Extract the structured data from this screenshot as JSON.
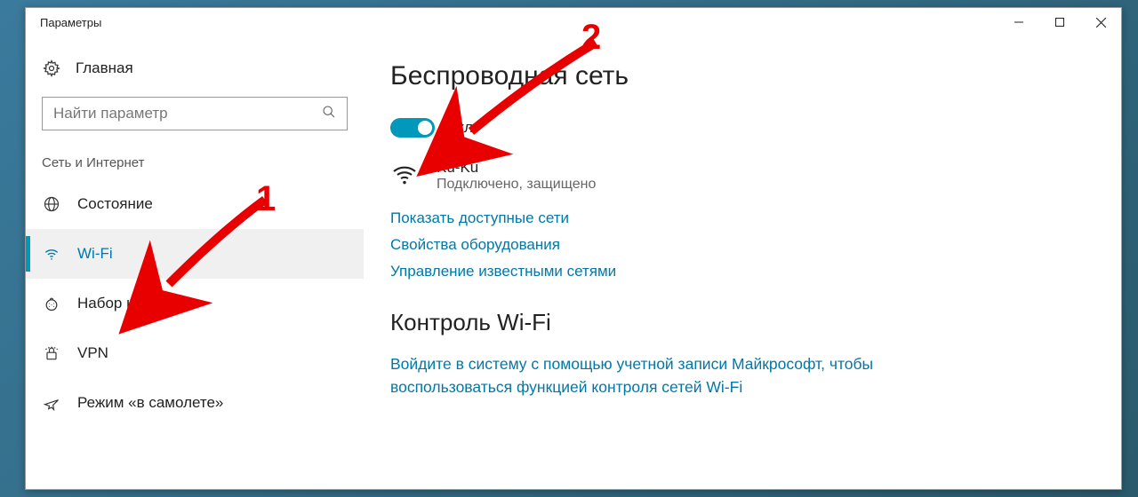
{
  "window": {
    "title": "Параметры"
  },
  "sidebar": {
    "home": "Главная",
    "search_placeholder": "Найти параметр",
    "section": "Сеть и Интернет",
    "items": [
      {
        "label": "Состояние"
      },
      {
        "label": "Wi-Fi"
      },
      {
        "label": "Набор номера"
      },
      {
        "label": "VPN"
      },
      {
        "label": "Режим «в самолете»"
      }
    ]
  },
  "main": {
    "heading": "Беспроводная сеть",
    "toggle_label": "Вкл.",
    "network": {
      "name": "Ku-Ku",
      "status": "Подключено, защищено"
    },
    "links": {
      "show": "Показать доступные сети",
      "props": "Свойства оборудования",
      "manage": "Управление известными сетями"
    },
    "section2": "Контроль Wi-Fi",
    "section2_text": "Войдите в систему с помощью учетной записи Майкрософт, чтобы воспользоваться функцией контроля сетей Wi-Fi"
  },
  "annotations": {
    "one": "1",
    "two": "2"
  }
}
